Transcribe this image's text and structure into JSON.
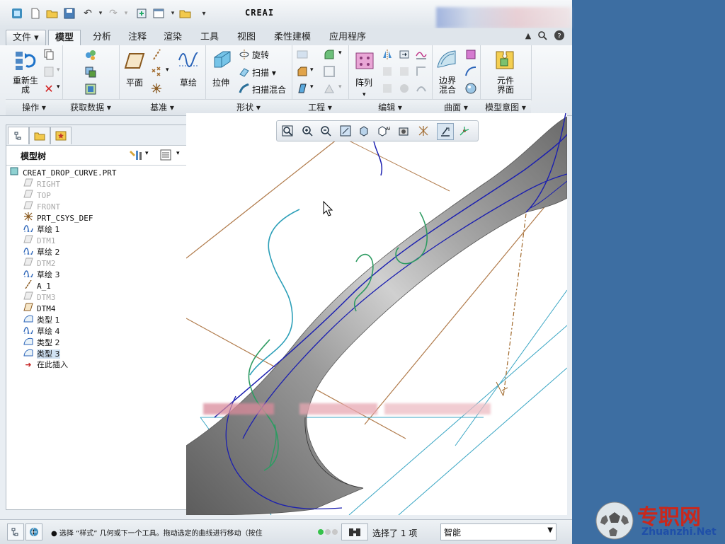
{
  "window": {
    "title": "CREAI"
  },
  "tabs": [
    "文件",
    "模型",
    "分析",
    "注释",
    "渲染",
    "工具",
    "视图",
    "柔性建模",
    "应用程序"
  ],
  "ribbon": {
    "regen_label": "重新生成",
    "plane_label": "平面",
    "sketch_label": "草绘",
    "extrude_label": "拉伸",
    "revolve_label": "旋转",
    "sweep_label": "扫描",
    "swept_blend_label": "扫描混合",
    "pattern_label": "阵列",
    "boundary_blend_label": "边界混合",
    "component_interface_label": "元件界面",
    "groups": [
      "操作",
      "获取数据",
      "基准",
      "形状",
      "工程",
      "编辑",
      "曲面",
      "模型意图"
    ]
  },
  "model_tree": {
    "title": "模型树",
    "items": [
      {
        "label": "CREAT_DROP_CURVE.PRT",
        "icon": "part-icon",
        "state": "normal"
      },
      {
        "label": "RIGHT",
        "icon": "datum-plane-icon",
        "state": "hidden"
      },
      {
        "label": "TOP",
        "icon": "datum-plane-icon",
        "state": "hidden"
      },
      {
        "label": "FRONT",
        "icon": "datum-plane-icon",
        "state": "hidden"
      },
      {
        "label": "PRT_CSYS_DEF",
        "icon": "csys-icon",
        "state": "normal"
      },
      {
        "label": "草绘 1",
        "icon": "sketch-icon",
        "state": "normal"
      },
      {
        "label": "DTM1",
        "icon": "datum-plane-icon",
        "state": "hidden"
      },
      {
        "label": "草绘 2",
        "icon": "sketch-icon",
        "state": "normal"
      },
      {
        "label": "DTM2",
        "icon": "datum-plane-icon",
        "state": "hidden"
      },
      {
        "label": "草绘 3",
        "icon": "sketch-icon",
        "state": "normal"
      },
      {
        "label": "A_1",
        "icon": "datum-axis-icon",
        "state": "normal"
      },
      {
        "label": "DTM3",
        "icon": "datum-plane-icon",
        "state": "hidden"
      },
      {
        "label": "DTM4",
        "icon": "datum-plane-icon",
        "state": "normal"
      },
      {
        "label": "类型 1",
        "icon": "style-icon",
        "state": "normal"
      },
      {
        "label": "草绘 4",
        "icon": "sketch-icon",
        "state": "normal"
      },
      {
        "label": "类型 2",
        "icon": "style-icon",
        "state": "normal"
      },
      {
        "label": "类型 3",
        "icon": "style-icon",
        "state": "selected"
      },
      {
        "label": "在此插入",
        "icon": "insert-arrow-icon",
        "state": "normal"
      }
    ]
  },
  "status": {
    "message": "● 选择 “样式” 几何或下一个工具。拖动选定的曲线进行移动（按住",
    "selected_count": "选择了 1 项",
    "filter_value": "智能"
  },
  "watermark": {
    "site_cn": "专职网",
    "site_en": "Zhuanzhi.Net"
  }
}
